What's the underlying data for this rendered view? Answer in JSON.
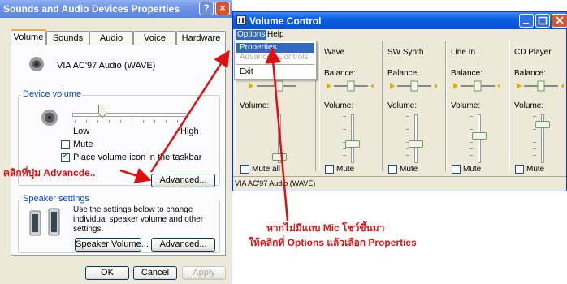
{
  "sound_dialog": {
    "title": "Sounds and Audio Devices Properties",
    "help_btn": "?",
    "close_btn": "×",
    "tabs": [
      "Volume",
      "Sounds",
      "Audio",
      "Voice",
      "Hardware"
    ],
    "device_name": "VIA AC'97 Audio (WAVE)",
    "device_volume_label": "Device volume",
    "low_label": "Low",
    "high_label": "High",
    "mute_label": "Mute",
    "taskbar_label": "Place volume icon in the taskbar",
    "advanced_label": "Advanced...",
    "speaker_settings_label": "Speaker settings",
    "speaker_desc": "Use the settings below to change individual speaker volume and other settings.",
    "speaker_volume_label": "Speaker Volume...",
    "speaker_advanced_label": "Advanced...",
    "ok_label": "OK",
    "cancel_label": "Cancel",
    "apply_label": "Apply"
  },
  "volume_control": {
    "title": "Volume Control",
    "menu": [
      "Options",
      "Help"
    ],
    "dropdown": [
      "Properties",
      "Advanced Controls",
      "Exit"
    ],
    "columns": [
      {
        "name": "",
        "mute": "Mute all"
      },
      {
        "name": "Wave",
        "mute": "Mute"
      },
      {
        "name": "SW Synth",
        "mute": "Mute"
      },
      {
        "name": "Line In",
        "mute": "Mute"
      },
      {
        "name": "CD Player",
        "mute": "Mute"
      }
    ],
    "balance_label": "Balance:",
    "volume_label": "Volume:",
    "status": "VIA AC'97 Audio (WAVE)"
  },
  "annotations": {
    "click_advanced": "คลิกที่ปุ่ม Advancde..",
    "note_line1": "หากไม่มีแถบ Mic โชว์ขึ้นมา",
    "note_line2": "ให้คลิกที่ Options แล้วเลือก Properties"
  },
  "colors": {
    "annotation_red": "#e01010",
    "xp_blue": "#0552d3",
    "selection": "#316ac5"
  }
}
